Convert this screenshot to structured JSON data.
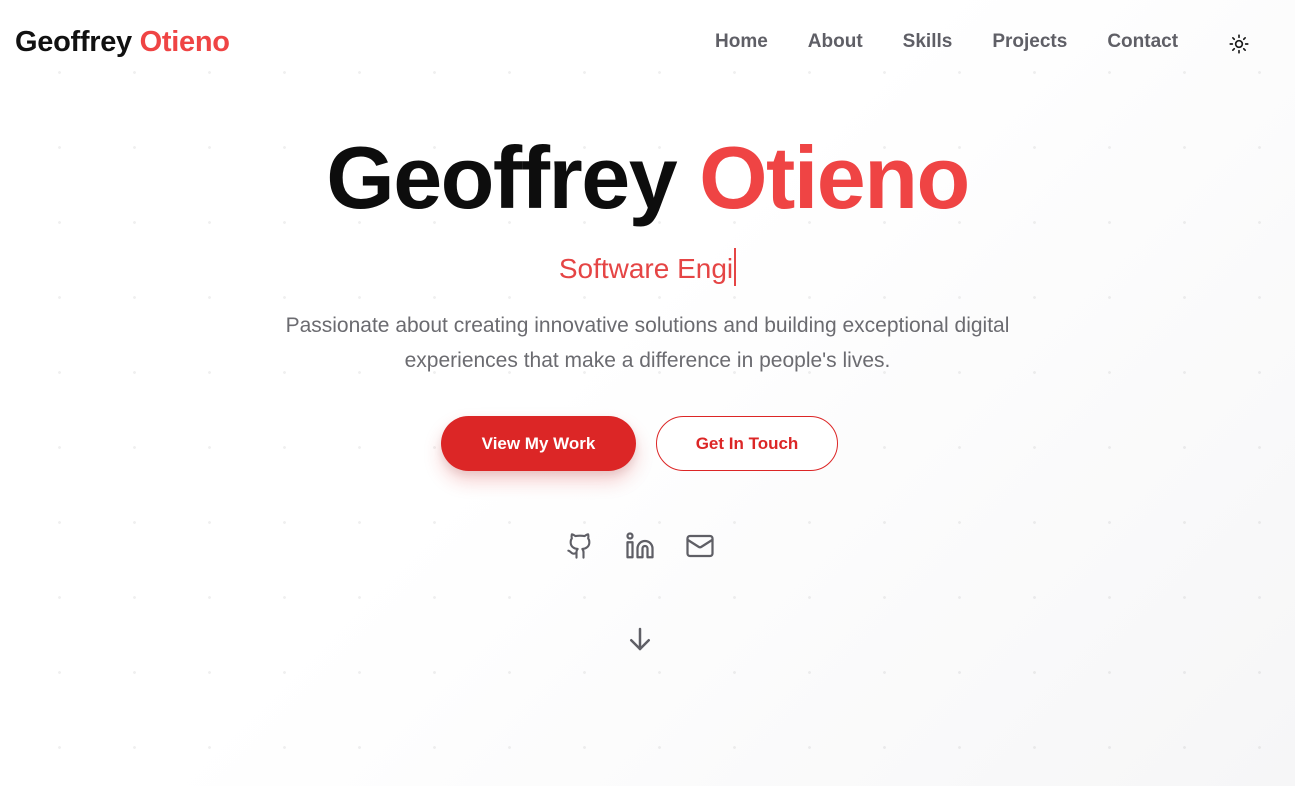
{
  "nav": {
    "logo_first": "Geoffrey",
    "logo_last": "Otieno",
    "links": [
      "Home",
      "About",
      "Skills",
      "Projects",
      "Contact"
    ],
    "theme_icon": "sun-icon"
  },
  "hero": {
    "name_first": "Geoffrey",
    "name_last": "Otieno",
    "typed_text": "Software Engi",
    "description_line1": "Passionate about creating innovative solutions and building exceptional digital",
    "description_line2": "experiences that make a difference in people's lives.",
    "primary_button": "View My Work",
    "secondary_button": "Get In Touch"
  },
  "socials": [
    {
      "name": "github-icon"
    },
    {
      "name": "linkedin-icon"
    },
    {
      "name": "mail-icon"
    }
  ],
  "scroll_icon": "arrow-down-icon",
  "colors": {
    "accent": "#ef4444",
    "button_red": "#dc2626",
    "text_dark": "#111111",
    "text_muted": "#6b6b70"
  }
}
